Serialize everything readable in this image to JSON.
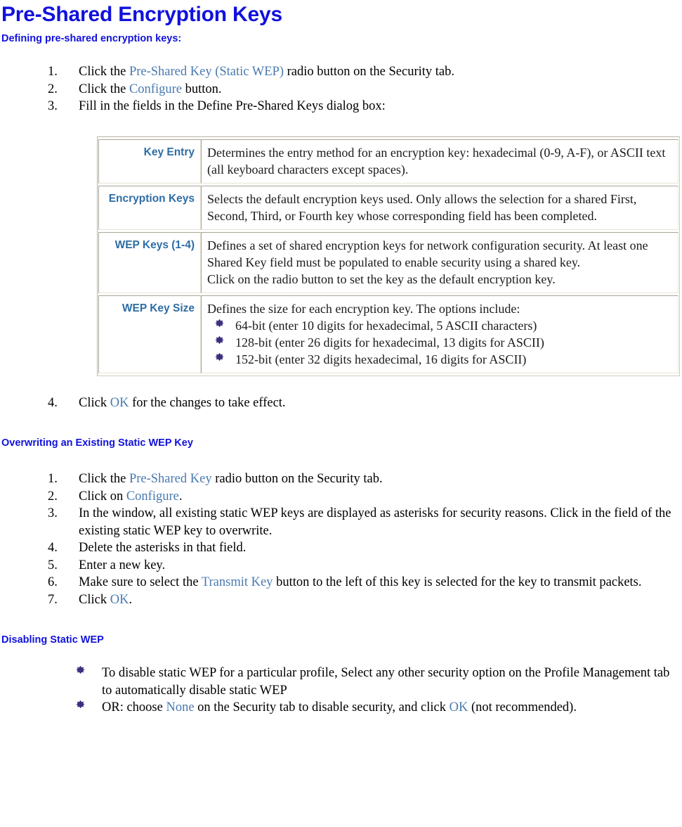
{
  "page": {
    "title": "Pre-Shared Encryption Keys",
    "subheading": "Defining pre-shared encryption keys:"
  },
  "defining_steps": [
    {
      "marker": "1.",
      "parts": [
        {
          "text": "Click the ",
          "style": "plain"
        },
        {
          "text": "Pre-Shared Key (Static WEP)",
          "style": "xref"
        },
        {
          "text": " radio button on the Security tab.",
          "style": "plain"
        }
      ]
    },
    {
      "marker": "2.",
      "parts": [
        {
          "text": "Click the ",
          "style": "plain"
        },
        {
          "text": "Configure",
          "style": "xref"
        },
        {
          "text": " button.",
          "style": "plain"
        }
      ]
    },
    {
      "marker": "3.",
      "parts": [
        {
          "text": "Fill in the fields in the Define Pre-Shared Keys dialog box:",
          "style": "plain"
        }
      ]
    }
  ],
  "table": {
    "rows": [
      {
        "label": "Key Entry",
        "paragraphs": [
          "Determines the entry method for an encryption key: hexadecimal (0-9, A-F), or ASCII text (all keyboard characters except spaces)."
        ],
        "bullets": []
      },
      {
        "label": "Encryption Keys",
        "paragraphs": [
          "Selects the default encryption keys used. Only allows the selection for a shared First, Second, Third, or Fourth key whose corresponding field has been completed."
        ],
        "bullets": []
      },
      {
        "label": "WEP Keys (1-4)",
        "paragraphs": [
          "Defines a set of shared encryption keys for network configuration security. At least one Shared Key field must be populated to enable security using a shared key.",
          "Click on the radio button to set the key as the default encryption key."
        ],
        "bullets": []
      },
      {
        "label": "WEP Key Size",
        "paragraphs": [
          "Defines the size for each encryption key. The options include:"
        ],
        "bullets": [
          "64-bit (enter 10 digits for hexadecimal, 5 ASCII characters)",
          "128-bit (enter 26 digits for hexadecimal, 13 digits for ASCII)",
          "152-bit (enter 32 digits hexadecimal, 16 digits for ASCII)"
        ]
      }
    ]
  },
  "defining_steps_after": [
    {
      "marker": "4.",
      "parts": [
        {
          "text": "Click ",
          "style": "plain"
        },
        {
          "text": "OK",
          "style": "xref"
        },
        {
          "text": " for the changes to take effect.",
          "style": "plain"
        }
      ]
    }
  ],
  "overwriting": {
    "heading": "Overwriting an Existing Static WEP Key",
    "steps": [
      {
        "marker": "1.",
        "parts": [
          {
            "text": "Click the ",
            "style": "plain"
          },
          {
            "text": "Pre-Shared Key",
            "style": "xref"
          },
          {
            "text": " radio button on the Security tab.",
            "style": "plain"
          }
        ]
      },
      {
        "marker": "2.",
        "parts": [
          {
            "text": "Click on ",
            "style": "plain"
          },
          {
            "text": "Configure",
            "style": "xref"
          },
          {
            "text": ".",
            "style": "plain"
          }
        ]
      },
      {
        "marker": "3.",
        "parts": [
          {
            "text": "In the window, all existing static WEP keys are displayed as asterisks for security reasons. Click in the field of the  existing static WEP key to overwrite.",
            "style": "plain"
          }
        ]
      },
      {
        "marker": "4.",
        "parts": [
          {
            "text": "Delete the asterisks in that field.",
            "style": "plain"
          }
        ]
      },
      {
        "marker": "5.",
        "parts": [
          {
            "text": "Enter a new key.",
            "style": "plain"
          }
        ]
      },
      {
        "marker": "6.",
        "parts": [
          {
            "text": "Make sure to select the ",
            "style": "plain"
          },
          {
            "text": "Transmit Key",
            "style": "xref"
          },
          {
            "text": " button to the left of this key is selected for the key to transmit packets.",
            "style": "plain"
          }
        ]
      },
      {
        "marker": "7.",
        "parts": [
          {
            "text": "Click ",
            "style": "plain"
          },
          {
            "text": "OK",
            "style": "xref"
          },
          {
            "text": ".",
            "style": "plain"
          }
        ]
      }
    ]
  },
  "disabling": {
    "heading": "Disabling Static WEP",
    "bullets": [
      {
        "parts": [
          {
            "text": "To disable static WEP for a particular profile, Select any other security option on the Profile Management tab to automatically disable static WEP",
            "style": "plain"
          }
        ]
      },
      {
        "parts": [
          {
            "text": "OR: choose ",
            "style": "plain"
          },
          {
            "text": "None",
            "style": "xref"
          },
          {
            "text": " on the Security tab to disable security, and click ",
            "style": "plain"
          },
          {
            "text": "OK",
            "style": "xref"
          },
          {
            "text": " (not recommended).",
            "style": "plain"
          }
        ]
      }
    ]
  },
  "colors": {
    "heading_blue": "#1111dd",
    "xref_blue": "#4a7aae",
    "table_label_blue": "#2e6da4",
    "bullet_purple": "#3b2f7f",
    "table_border": "#cfcbb8"
  },
  "icons": {
    "bullet": "diamond-bullet-icon"
  }
}
